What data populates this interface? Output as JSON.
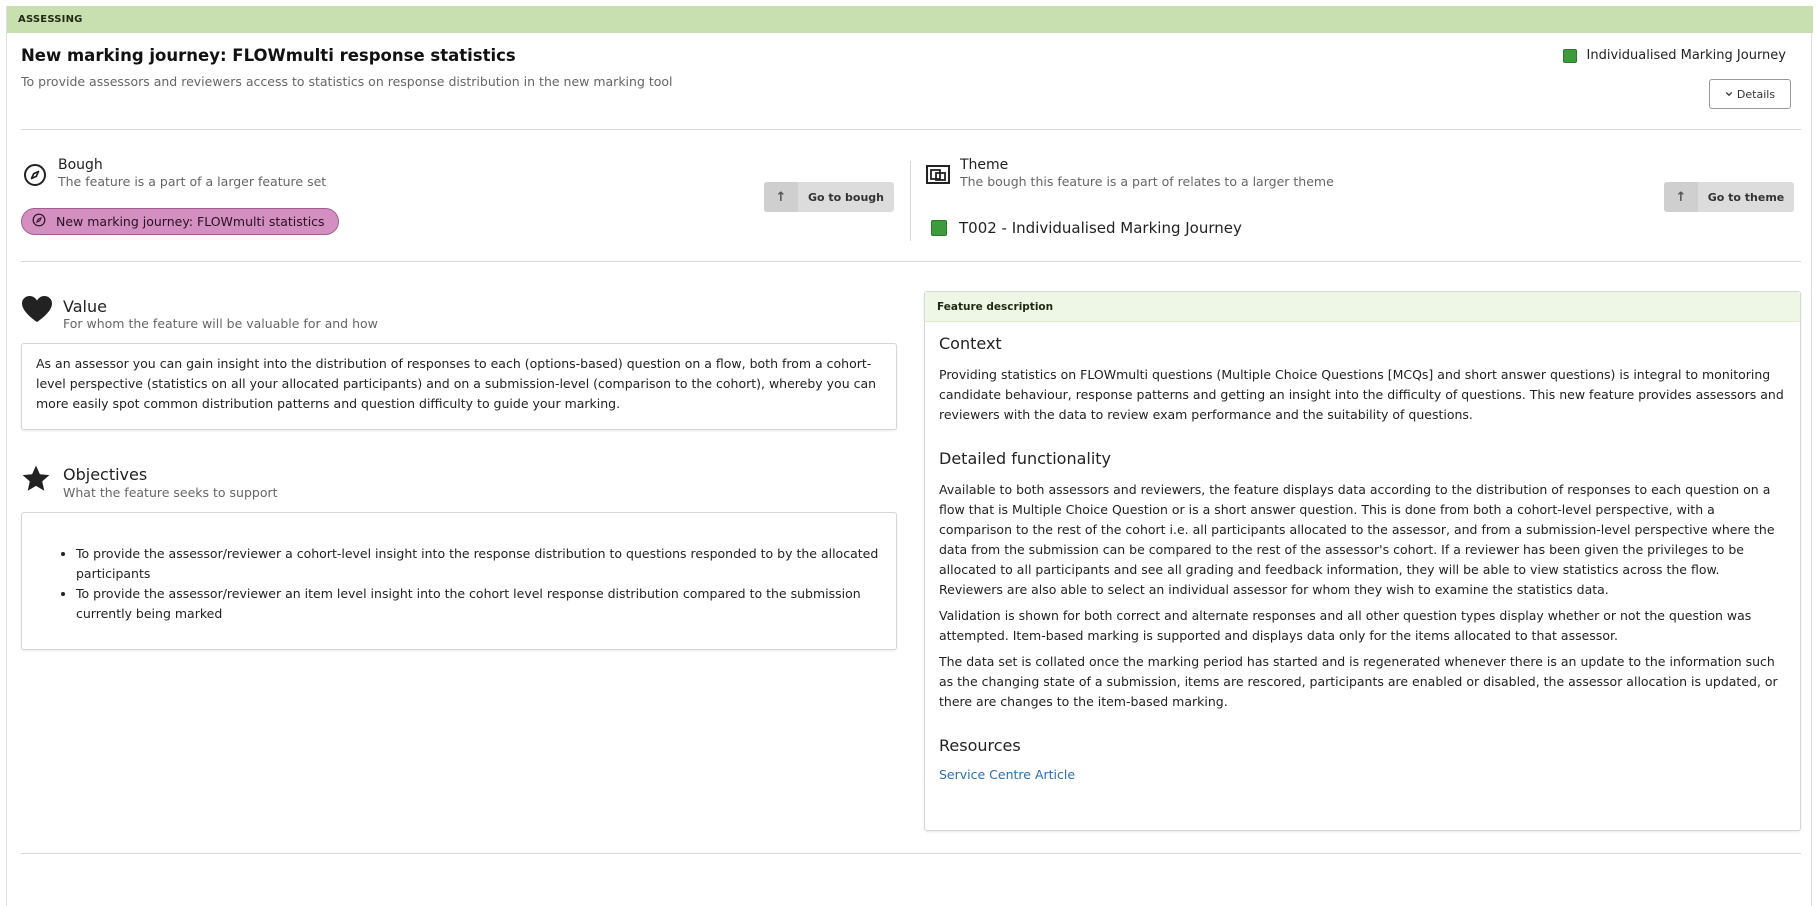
{
  "status": {
    "label": "ASSESSING"
  },
  "header": {
    "title": "New marking journey: FLOWmulti response statistics",
    "subtitle": "To provide assessors and reviewers access to statistics on response distribution in the new marking tool",
    "tag_label": "Individualised Marking Journey",
    "tag_color": "#3d9a3d",
    "details_label": "Details"
  },
  "bough": {
    "title": "Bough",
    "subtitle": "The feature is a part of a larger feature set",
    "pill_label": "New marking journey: FLOWmulti statistics",
    "pill_color": "#d28fc0",
    "button_label": "Go to bough"
  },
  "theme": {
    "title": "Theme",
    "subtitle": "The bough this feature is a part of relates to a larger theme",
    "item_label": "T002 - Individualised Marking Journey",
    "item_color": "#3d9a3d",
    "button_label": "Go to theme"
  },
  "value": {
    "title": "Value",
    "subtitle": "For whom the feature will be valuable for and how",
    "text": "As an assessor you can gain insight into the distribution of responses to each (options-based) question on a flow, both from a cohort-level perspective (statistics on all your allocated participants) and on a submission-level (comparison to the cohort), whereby you can more easily spot common distribution patterns and question difficulty to guide your marking."
  },
  "objectives": {
    "title": "Objectives",
    "subtitle": "What the feature seeks to support",
    "items": [
      "To provide the assessor/reviewer a cohort-level insight into the response distribution to questions responded to by the allocated participants",
      "To provide the assessor/reviewer an item level insight into the cohort level response distribution compared to the submission currently being marked"
    ]
  },
  "description": {
    "header": "Feature description",
    "context_title": "Context",
    "context_text": "Providing statistics on FLOWmulti questions (Multiple Choice Questions [MCQs] and short answer questions) is integral to monitoring candidate behaviour, response patterns and getting an insight into the difficulty of questions. This new feature provides assessors and reviewers with the data to review exam performance and the suitability of questions.",
    "functionality_title": "Detailed functionality",
    "functionality_p1": "Available to both assessors and reviewers, the feature displays data according to the distribution of responses to each question on a flow that is Multiple Choice Question or is a short answer question. This is done from both a cohort-level perspective, with a comparison to the rest of the cohort i.e. all participants allocated to the assessor, and from a submission-level perspective where the data from the submission can be compared to the rest of the assessor's cohort. If a reviewer has been given the privileges to be allocated to all participants and see all grading and feedback information, they will be able to view statistics across the flow. Reviewers are also able to select an individual assessor for whom they wish to examine the statistics data.",
    "functionality_p2": "Validation is shown for both correct and alternate responses and all other question types display whether or not the question was attempted. Item-based marking is supported and displays data only for the items allocated to that assessor.",
    "functionality_p3": "The data set is collated once the marking period has started and is regenerated whenever there is an update to the information such as the changing state of a submission, items are rescored, participants are enabled or disabled, the assessor allocation is updated, or there are changes to the item-based marking.",
    "resources_title": "Resources",
    "resource_link": "Service Centre Article"
  }
}
